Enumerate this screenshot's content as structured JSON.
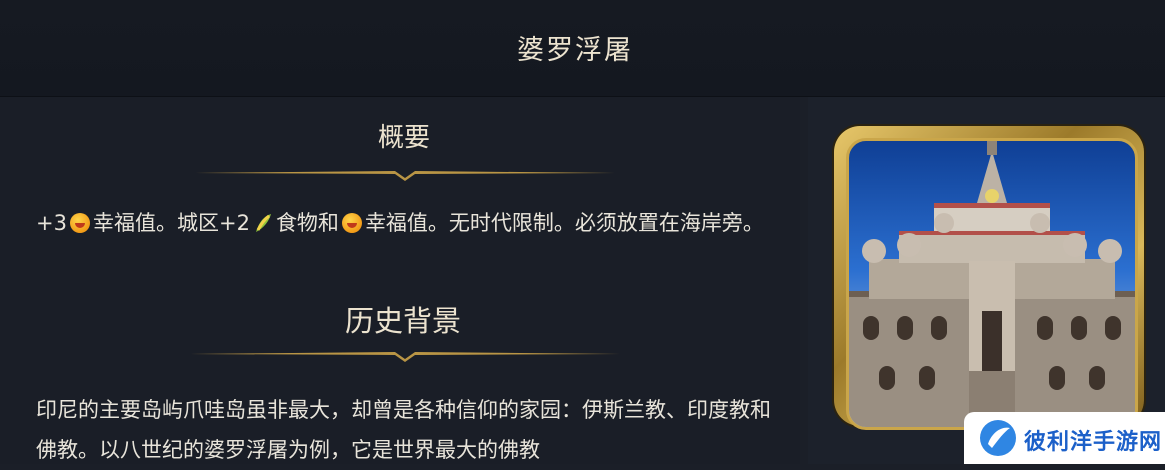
{
  "header": {
    "title": "婆罗浮屠"
  },
  "overview": {
    "heading": "概要",
    "text_part1": "+3",
    "text_part2": "幸福值。城区+2",
    "text_part3": "食物和",
    "text_part4": "幸福值。无时代限制。必须放置在海岸旁。",
    "happiness_icon": "happiness-emoji-icon",
    "food_icon": "food-corn-icon"
  },
  "history": {
    "heading": "历史背景",
    "text": "印尼的主要岛屿爪哇岛虽非最大，却曾是各种信仰的家园：伊斯兰教、印度教和佛教。以八世纪的婆罗浮屠为例，它是世界最大的佛教"
  },
  "portrait": {
    "icon": "borobudur-temple-portrait"
  },
  "watermark": {
    "text": "彼利洋手游网",
    "logo": "watermark-logo-icon"
  },
  "colors": {
    "background": "#1b1f28",
    "gold": "#c9a44d",
    "text": "#e8e4da"
  }
}
